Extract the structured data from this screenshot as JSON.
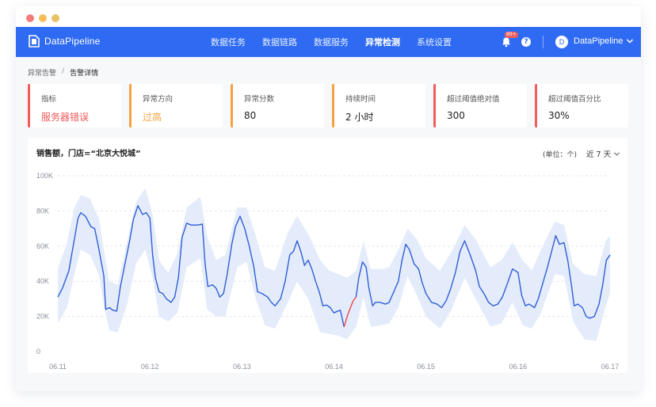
{
  "app": {
    "name": "DataPipeline",
    "nav": [
      "数据任务",
      "数据链路",
      "数据服务",
      "异常检测",
      "系统设置"
    ],
    "active_index": 3,
    "notification_badge": "99+",
    "help": "?",
    "user": {
      "initial": "D",
      "name": "DataPipeline"
    }
  },
  "breadcrumb": {
    "parent": "异常告警",
    "separator": "/",
    "current": "告警详情"
  },
  "cards": [
    {
      "label": "指标",
      "value": "服务器错误",
      "accent": "#f05b5b",
      "value_color": "#f0595a"
    },
    {
      "label": "异常方向",
      "value": "过高",
      "accent": "#f5a040",
      "value_color": "#f5a341"
    },
    {
      "label": "异常分数",
      "value": "80",
      "accent": "#f5a040",
      "value_color": "#222222"
    },
    {
      "label": "持续时间",
      "value": "2 小时",
      "accent": "#f5a040",
      "value_color": "#222222"
    },
    {
      "label": "超过阈值绝对值",
      "value": "300",
      "accent": "#f05b5b",
      "value_color": "#222222"
    },
    {
      "label": "超过阈值百分比",
      "value": "30%",
      "accent": "#f05b5b",
      "value_color": "#222222"
    }
  ],
  "chart_panel": {
    "title": "销售额，门店=“北京大悦城”",
    "unit": "(单位：个)",
    "range": "近 7 天"
  },
  "chart_data": {
    "type": "line",
    "title": "销售额，门店=“北京大悦城”",
    "xlabel": "",
    "ylabel": "",
    "ylim": [
      0,
      100000
    ],
    "yticks": [
      "0",
      "20K",
      "40K",
      "60K",
      "80K",
      "100K"
    ],
    "xticks": [
      "06.11",
      "06.12",
      "06.13",
      "06.14",
      "06.15",
      "06.16",
      "06.17"
    ],
    "x_day_range": [
      0,
      6
    ],
    "grid": true,
    "colors": {
      "line": "#2f5fd6",
      "band": "#e4ecfb",
      "anomaly": "#e84848"
    },
    "series": [
      {
        "values": [
          [
            0.0,
            31000
          ],
          [
            0.05,
            36000
          ],
          [
            0.12,
            46000
          ],
          [
            0.18,
            64000
          ],
          [
            0.22,
            76000
          ],
          [
            0.25,
            79000
          ],
          [
            0.3,
            77000
          ],
          [
            0.36,
            71000
          ],
          [
            0.4,
            70000
          ],
          [
            0.44,
            60000
          ],
          [
            0.5,
            43000
          ],
          [
            0.52,
            24000
          ],
          [
            0.56,
            25000
          ],
          [
            0.6,
            23500
          ],
          [
            0.64,
            23000
          ],
          [
            0.68,
            37000
          ],
          [
            0.73,
            50000
          ],
          [
            0.78,
            63000
          ],
          [
            0.82,
            75000
          ],
          [
            0.87,
            83000
          ],
          [
            0.92,
            78000
          ],
          [
            0.96,
            79000
          ],
          [
            1.0,
            76000
          ],
          [
            1.03,
            55000
          ],
          [
            1.06,
            42000
          ],
          [
            1.1,
            34000
          ],
          [
            1.14,
            33000
          ],
          [
            1.18,
            30000
          ],
          [
            1.23,
            28000
          ],
          [
            1.27,
            31000
          ],
          [
            1.31,
            42000
          ],
          [
            1.35,
            65000
          ],
          [
            1.4,
            73000
          ],
          [
            1.45,
            72000
          ],
          [
            1.52,
            72000
          ],
          [
            1.57,
            72500
          ],
          [
            1.6,
            50000
          ],
          [
            1.63,
            37000
          ],
          [
            1.68,
            38000
          ],
          [
            1.72,
            36000
          ],
          [
            1.76,
            31000
          ],
          [
            1.8,
            33000
          ],
          [
            1.84,
            44000
          ],
          [
            1.89,
            61000
          ],
          [
            1.93,
            71000
          ],
          [
            1.98,
            77000
          ],
          [
            2.03,
            70000
          ],
          [
            2.08,
            60000
          ],
          [
            2.13,
            48000
          ],
          [
            2.17,
            34000
          ],
          [
            2.22,
            33000
          ],
          [
            2.28,
            31000
          ],
          [
            2.32,
            28000
          ],
          [
            2.36,
            26000
          ],
          [
            2.42,
            30000
          ],
          [
            2.47,
            40000
          ],
          [
            2.52,
            55000
          ],
          [
            2.56,
            57000
          ],
          [
            2.6,
            63000
          ],
          [
            2.64,
            57000
          ],
          [
            2.68,
            49000
          ],
          [
            2.72,
            52000
          ],
          [
            2.76,
            47000
          ],
          [
            2.8,
            40000
          ],
          [
            2.84,
            34000
          ],
          [
            2.88,
            26000
          ],
          [
            2.92,
            26500
          ],
          [
            2.96,
            25000
          ],
          [
            3.0,
            22000
          ],
          [
            3.04,
            23000
          ],
          [
            3.07,
            23500
          ],
          [
            3.11,
            14000
          ]
        ]
      },
      {
        "name": "",
        "style": "anomaly",
        "values": [
          [
            3.11,
            14000
          ],
          [
            3.15,
            21000
          ],
          [
            3.18,
            25000
          ],
          [
            3.21,
            29000
          ],
          [
            3.24,
            31000
          ]
        ]
      },
      {
        "values": [
          [
            3.24,
            31000
          ],
          [
            3.27,
            42000
          ],
          [
            3.31,
            51000
          ],
          [
            3.35,
            48000
          ],
          [
            3.38,
            36000
          ],
          [
            3.42,
            26000
          ],
          [
            3.45,
            28000
          ],
          [
            3.5,
            28000
          ],
          [
            3.56,
            27000
          ],
          [
            3.6,
            28000
          ],
          [
            3.65,
            34000
          ],
          [
            3.7,
            40000
          ],
          [
            3.74,
            52000
          ],
          [
            3.78,
            61000
          ],
          [
            3.82,
            58000
          ],
          [
            3.87,
            50000
          ],
          [
            3.92,
            47000
          ],
          [
            3.96,
            39000
          ],
          [
            4.0,
            33000
          ],
          [
            4.06,
            28000
          ],
          [
            4.12,
            27000
          ],
          [
            4.17,
            25000
          ],
          [
            4.22,
            29000
          ],
          [
            4.27,
            36000
          ],
          [
            4.32,
            45000
          ],
          [
            4.37,
            57000
          ],
          [
            4.42,
            63000
          ],
          [
            4.48,
            55000
          ],
          [
            4.54,
            46000
          ],
          [
            4.58,
            37000
          ],
          [
            4.63,
            33000
          ],
          [
            4.68,
            28000
          ],
          [
            4.73,
            26000
          ],
          [
            4.78,
            27000
          ],
          [
            4.83,
            31000
          ],
          [
            4.88,
            38000
          ],
          [
            4.94,
            47000
          ],
          [
            5.0,
            45000
          ],
          [
            5.04,
            32000
          ],
          [
            5.08,
            26000
          ],
          [
            5.12,
            27000
          ],
          [
            5.18,
            25000
          ],
          [
            5.22,
            30000
          ],
          [
            5.27,
            39000
          ],
          [
            5.32,
            48000
          ],
          [
            5.37,
            58000
          ],
          [
            5.41,
            66000
          ],
          [
            5.45,
            61000
          ],
          [
            5.5,
            62000
          ],
          [
            5.54,
            52000
          ],
          [
            5.58,
            38000
          ],
          [
            5.61,
            26000
          ],
          [
            5.65,
            27000
          ],
          [
            5.7,
            25000
          ],
          [
            5.74,
            20000
          ],
          [
            5.78,
            19000
          ],
          [
            5.83,
            20000
          ],
          [
            5.88,
            27000
          ],
          [
            5.92,
            38000
          ],
          [
            5.96,
            52000
          ],
          [
            6.0,
            55000
          ]
        ]
      }
    ],
    "band": {
      "upper": [
        [
          0.0,
          47000
        ],
        [
          0.1,
          62000
        ],
        [
          0.18,
          82000
        ],
        [
          0.25,
          89000
        ],
        [
          0.35,
          87000
        ],
        [
          0.45,
          75000
        ],
        [
          0.5,
          58000
        ],
        [
          0.56,
          40000
        ],
        [
          0.65,
          38000
        ],
        [
          0.75,
          62000
        ],
        [
          0.85,
          85000
        ],
        [
          0.95,
          93000
        ],
        [
          1.03,
          78000
        ],
        [
          1.1,
          52000
        ],
        [
          1.2,
          45000
        ],
        [
          1.3,
          56000
        ],
        [
          1.4,
          82000
        ],
        [
          1.55,
          88000
        ],
        [
          1.62,
          66000
        ],
        [
          1.72,
          52000
        ],
        [
          1.82,
          55000
        ],
        [
          1.95,
          82000
        ],
        [
          2.05,
          82000
        ],
        [
          2.15,
          66000
        ],
        [
          2.25,
          48000
        ],
        [
          2.36,
          46000
        ],
        [
          2.5,
          68000
        ],
        [
          2.6,
          77000
        ],
        [
          2.72,
          67000
        ],
        [
          2.85,
          52000
        ],
        [
          2.95,
          46000
        ],
        [
          3.05,
          44000
        ],
        [
          3.14,
          42000
        ],
        [
          3.24,
          46000
        ],
        [
          3.32,
          63000
        ],
        [
          3.4,
          47000
        ],
        [
          3.52,
          47000
        ],
        [
          3.6,
          48000
        ],
        [
          3.7,
          58000
        ],
        [
          3.8,
          70000
        ],
        [
          3.9,
          64000
        ],
        [
          4.0,
          53000
        ],
        [
          4.15,
          46000
        ],
        [
          4.28,
          57000
        ],
        [
          4.42,
          72000
        ],
        [
          4.55,
          63000
        ],
        [
          4.7,
          48000
        ],
        [
          4.82,
          52000
        ],
        [
          4.94,
          62000
        ],
        [
          5.05,
          52000
        ],
        [
          5.15,
          46000
        ],
        [
          5.25,
          58000
        ],
        [
          5.4,
          74000
        ],
        [
          5.5,
          72000
        ],
        [
          5.6,
          50000
        ],
        [
          5.72,
          44000
        ],
        [
          5.85,
          43000
        ],
        [
          5.95,
          63000
        ],
        [
          6.0,
          66000
        ]
      ],
      "lower": [
        [
          0.0,
          16000
        ],
        [
          0.1,
          25000
        ],
        [
          0.18,
          44000
        ],
        [
          0.25,
          58000
        ],
        [
          0.35,
          55000
        ],
        [
          0.45,
          43000
        ],
        [
          0.5,
          26000
        ],
        [
          0.56,
          12000
        ],
        [
          0.65,
          11000
        ],
        [
          0.75,
          26000
        ],
        [
          0.85,
          50000
        ],
        [
          0.95,
          58000
        ],
        [
          1.03,
          42000
        ],
        [
          1.1,
          20000
        ],
        [
          1.2,
          17000
        ],
        [
          1.3,
          22000
        ],
        [
          1.4,
          48000
        ],
        [
          1.55,
          53000
        ],
        [
          1.62,
          24000
        ],
        [
          1.72,
          20000
        ],
        [
          1.82,
          20000
        ],
        [
          1.95,
          48000
        ],
        [
          2.05,
          51000
        ],
        [
          2.15,
          30000
        ],
        [
          2.25,
          15000
        ],
        [
          2.36,
          13000
        ],
        [
          2.5,
          28000
        ],
        [
          2.6,
          40000
        ],
        [
          2.72,
          30000
        ],
        [
          2.85,
          11000
        ],
        [
          2.95,
          10000
        ],
        [
          3.05,
          9000
        ],
        [
          3.14,
          7000
        ],
        [
          3.24,
          14000
        ],
        [
          3.32,
          31000
        ],
        [
          3.4,
          14000
        ],
        [
          3.52,
          15000
        ],
        [
          3.6,
          16000
        ],
        [
          3.7,
          25000
        ],
        [
          3.8,
          43000
        ],
        [
          3.9,
          32000
        ],
        [
          4.0,
          20000
        ],
        [
          4.15,
          13000
        ],
        [
          4.28,
          24000
        ],
        [
          4.42,
          42000
        ],
        [
          4.55,
          29000
        ],
        [
          4.7,
          14000
        ],
        [
          4.82,
          16000
        ],
        [
          4.94,
          28000
        ],
        [
          5.05,
          15000
        ],
        [
          5.15,
          13000
        ],
        [
          5.25,
          22000
        ],
        [
          5.4,
          44000
        ],
        [
          5.5,
          43000
        ],
        [
          5.6,
          17000
        ],
        [
          5.72,
          7000
        ],
        [
          5.85,
          6000
        ],
        [
          5.95,
          25000
        ],
        [
          6.0,
          33000
        ]
      ]
    }
  }
}
